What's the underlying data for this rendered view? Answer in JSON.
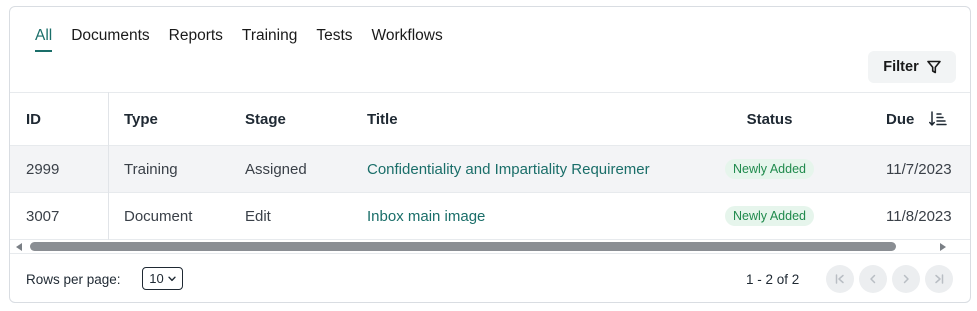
{
  "tabs": [
    {
      "label": "All",
      "active": true
    },
    {
      "label": "Documents"
    },
    {
      "label": "Reports"
    },
    {
      "label": "Training"
    },
    {
      "label": "Tests"
    },
    {
      "label": "Workflows"
    }
  ],
  "filter": {
    "label": "Filter",
    "icon": "filter-icon"
  },
  "table": {
    "columns": [
      "ID",
      "Type",
      "Stage",
      "Title",
      "Status",
      "Due"
    ],
    "sort_icon": "sort-descending-icon",
    "rows": [
      {
        "id": "2999",
        "type": "Training",
        "stage": "Assigned",
        "title": "Confidentiality and Impartiality Requiremer",
        "status": "Newly Added",
        "due": "11/7/2023"
      },
      {
        "id": "3007",
        "type": "Document",
        "stage": "Edit",
        "title": "Inbox main image",
        "status": "Newly Added",
        "due": "11/8/2023"
      }
    ]
  },
  "pagination": {
    "rows_per_page_label": "Rows per page:",
    "rows_per_page_value": "10",
    "range_text": "1 - 2 of 2",
    "buttons": [
      "first-page-icon",
      "previous-page-icon",
      "next-page-icon",
      "last-page-icon"
    ]
  },
  "colors": {
    "accent": "#1a6e69",
    "badge_bg": "#e6f5ec",
    "badge_text": "#1f8a4c",
    "row_alt": "#f3f4f6"
  }
}
